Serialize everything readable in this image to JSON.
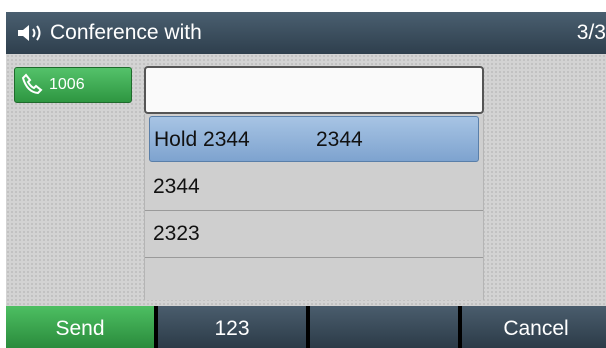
{
  "titlebar": {
    "title": "Conference with",
    "count": "3/3"
  },
  "line_key": {
    "number": "1006"
  },
  "input": {
    "value": ""
  },
  "list": {
    "items": [
      {
        "name": "Hold 2344",
        "number": "2344",
        "selected": true
      },
      {
        "name": "2344",
        "number": "",
        "selected": false
      },
      {
        "name": "2323",
        "number": "",
        "selected": false
      }
    ]
  },
  "softkeys": [
    "Send",
    "123",
    "",
    "Cancel"
  ],
  "colors": {
    "send": "#3aa650",
    "selected": "#8fb2db",
    "titlebar": "#3b4f5f"
  }
}
